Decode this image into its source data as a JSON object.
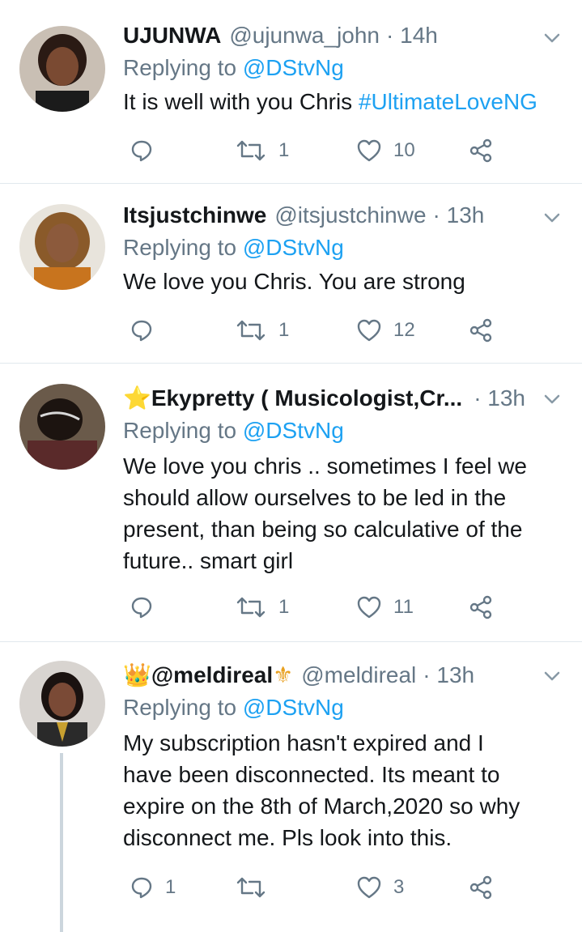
{
  "tweets": [
    {
      "name": "UJUNWA",
      "handle": "@ujunwa_john",
      "time": "· 14h",
      "replying_label": "Replying to",
      "replying_to": "@DStvNg",
      "text": "It is well with you Chris ",
      "hashtag": "#UltimateLoveNG",
      "replies": "",
      "retweets": "1",
      "likes": "10"
    },
    {
      "name": "Itsjustchinwe",
      "handle": "@itsjustchinwe",
      "time": "· 13h",
      "replying_label": "Replying to",
      "replying_to": "@DStvNg",
      "text": "We love you Chris. You are strong",
      "replies": "",
      "retweets": "1",
      "likes": "12"
    },
    {
      "name_prefix": "⭐",
      "name": "Ekypretty ( Musicologist,Cr...",
      "handle": "",
      "time": "· 13h",
      "replying_label": "Replying to",
      "replying_to": "@DStvNg",
      "text_lines": [
        "We love you chris .. sometimes I feel we",
        "should allow ourselves to be led in the",
        "present, than  being so calculative of the",
        "future.. smart girl"
      ],
      "replies": "",
      "retweets": "1",
      "likes": "11"
    },
    {
      "name_prefix": "👑",
      "name": "@meldireal",
      "name_suffix": "⚜",
      "handle": "@meldireal",
      "time": "· 13h",
      "replying_label": "Replying to",
      "replying_to": "@DStvNg",
      "text_lines": [
        "My subscription hasn't expired and I",
        "have been disconnected. Its meant to",
        "expire on the 8th of March,2020 so why",
        "disconnect me. Pls look into this."
      ],
      "replies": "1",
      "retweets": "",
      "likes": "3"
    }
  ],
  "colors": {
    "accent": "#1da1f2",
    "secondary_text": "#657786",
    "divider": "#e1e8ed"
  },
  "icons": [
    "reply-icon",
    "retweet-icon",
    "like-icon",
    "share-icon",
    "chevron-down-icon"
  ]
}
